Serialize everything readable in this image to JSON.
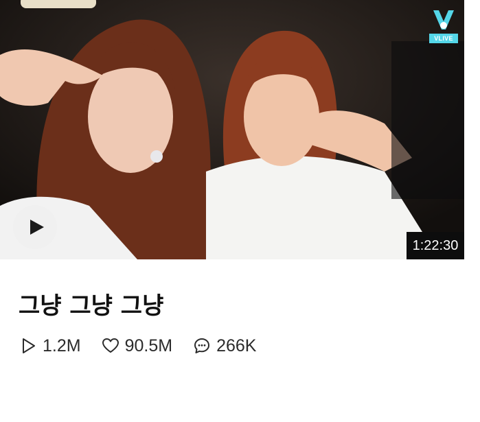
{
  "video": {
    "title": "그냥 그냥 그냥",
    "duration": "1:22:30",
    "badge": "VLIVE"
  },
  "stats": {
    "plays": "1.2M",
    "likes": "90.5M",
    "comments": "266K"
  },
  "icons": [
    "play-icon",
    "vlive-logo-icon",
    "play-count-icon",
    "heart-icon",
    "comment-icon"
  ]
}
